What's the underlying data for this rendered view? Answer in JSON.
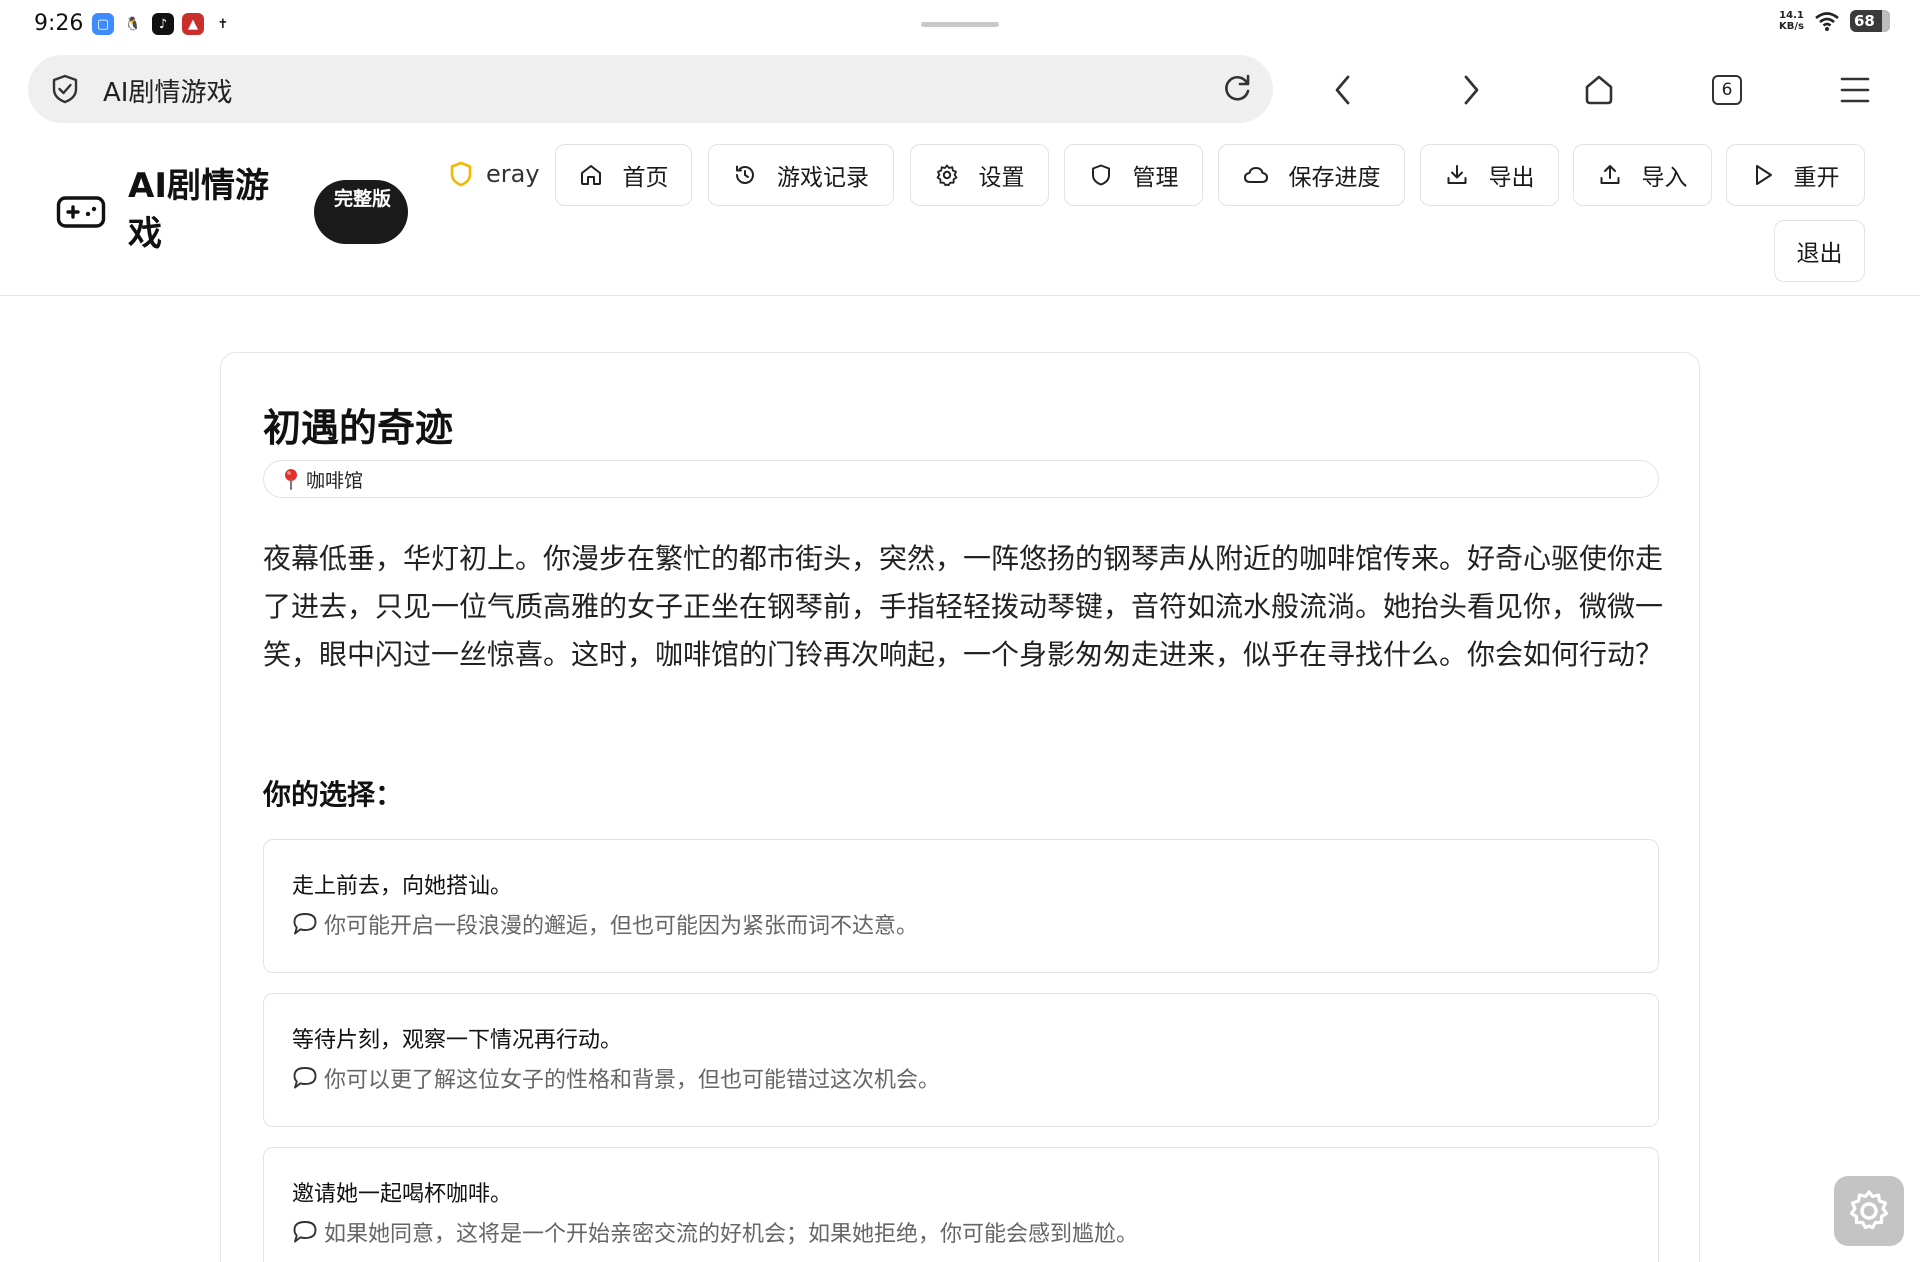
{
  "status_bar": {
    "time": "9:26",
    "net_speed_value": "14.1",
    "net_speed_unit": "KB/s",
    "battery": "68",
    "app_icons": [
      "blue-square-icon",
      "penguin-icon",
      "tiktok-icon",
      "red-app-icon",
      "accessibility-icon"
    ]
  },
  "browser": {
    "url_text": "AI剧情游戏",
    "tab_count": "6"
  },
  "app": {
    "title": "AI剧情游戏",
    "edition_badge": "完整版",
    "username": "eray",
    "nav": {
      "home": "首页",
      "history": "游戏记录",
      "settings": "设置",
      "admin": "管理",
      "save": "保存进度",
      "export": "导出",
      "import": "导入",
      "restart": "重开",
      "logout": "退出"
    }
  },
  "scene": {
    "title": "初遇的奇迹",
    "location": "咖啡馆",
    "narrative": "夜幕低垂，华灯初上。你漫步在繁忙的都市街头，突然，一阵悠扬的钢琴声从附近的咖啡馆传来。好奇心驱使你走了进去，只见一位气质高雅的女子正坐在钢琴前，手指轻轻拨动琴键，音符如流水般流淌。她抬头看见你，微微一笑，眼中闪过一丝惊喜。这时，咖啡馆的门铃再次响起，一个身影匆匆走进来，似乎在寻找什么。你会如何行动？",
    "choices_heading": "你的选择：",
    "choices": [
      {
        "text": "走上前去，向她搭讪。",
        "hint": "你可能开启一段浪漫的邂逅，但也可能因为紧张而词不达意。"
      },
      {
        "text": "等待片刻，观察一下情况再行动。",
        "hint": "你可以更了解这位女子的性格和背景，但也可能错过这次机会。"
      },
      {
        "text": "邀请她一起喝杯咖啡。",
        "hint": "如果她同意，这将是一个开始亲密交流的好机会；如果她拒绝，你可能会感到尴尬。"
      }
    ]
  },
  "colors": {
    "accent_shield": "#f5b800",
    "badge_bg": "#1a1a1a",
    "border": "#e3e3e3",
    "hint_text": "#666666"
  }
}
